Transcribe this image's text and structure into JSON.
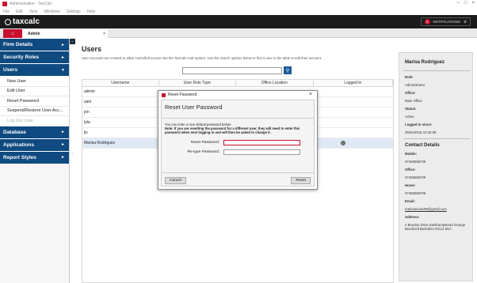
{
  "window": {
    "title": "Administration - TaxCalc"
  },
  "menu": [
    "File",
    "Edit",
    "View",
    "Windows",
    "Settings",
    "Help"
  ],
  "brand": {
    "logo_text": "taxcalc",
    "notifications_count": "2",
    "notifications_label": "NOTIFICATIONS"
  },
  "tabs": {
    "admin_label": "Admin"
  },
  "sidebar": {
    "sections": [
      {
        "label": "Firm Details"
      },
      {
        "label": "Security Roles"
      },
      {
        "label": "Users"
      },
      {
        "label": "Database"
      },
      {
        "label": "Applications"
      },
      {
        "label": "Report Styles"
      }
    ],
    "user_items": [
      {
        "label": "New User"
      },
      {
        "label": "Edit User"
      },
      {
        "label": "Reset Password"
      },
      {
        "label": "Suspend/Restore User Acc..."
      },
      {
        "label": "Log Out User"
      }
    ]
  },
  "main": {
    "title": "Users",
    "description": "User accounts are created to allow controlled access into the TaxCalc Hub system. Use the search options below to find a user in the table to edit their account.",
    "search_value": "",
    "columns": [
      "Username",
      "User Role Type",
      "Office Location",
      "Logged in"
    ],
    "rows": [
      {
        "username": "admin"
      },
      {
        "username": "sam"
      },
      {
        "username": "jon"
      },
      {
        "username": "tyla"
      },
      {
        "username": "jis"
      },
      {
        "username": "Marisa Rodriguez"
      }
    ]
  },
  "details": {
    "name": "Marisa Rodriguez",
    "role_label": "Role:",
    "role": "Administrator",
    "office_label": "Office:",
    "office": "Main Office",
    "status_label": "Status:",
    "status": "Active",
    "logged_label": "Logged in since:",
    "logged": "25/04/2018 10:40:39",
    "contact_heading": "Contact Details",
    "mobile_label": "Mobile:",
    "mobile": "07468588709",
    "office_phone_label": "Office:",
    "office_phone": "07468588709",
    "home_label": "Home:",
    "home": "07468588709",
    "email_label": "Email:",
    "email": "marisamusic99@gmail.com",
    "address_label": "Address:",
    "address": "4 Beedon Drive Easthampstead Grange Bracknell Berkshire RG12 8GJ"
  },
  "dialog": {
    "title": "Reset Password",
    "heading": "Reset User Password",
    "intro": "You can enter a new default password below:",
    "note": "Note: If you are resetting the password for a different user, they will need to enter this password when next logging in and will then be asked to change it.",
    "reset_label": "Reset Password:",
    "reset_value": "",
    "retype_label": "Re-type Password:",
    "retype_value": "",
    "cancel": "Cancel",
    "reset": "Reset"
  }
}
